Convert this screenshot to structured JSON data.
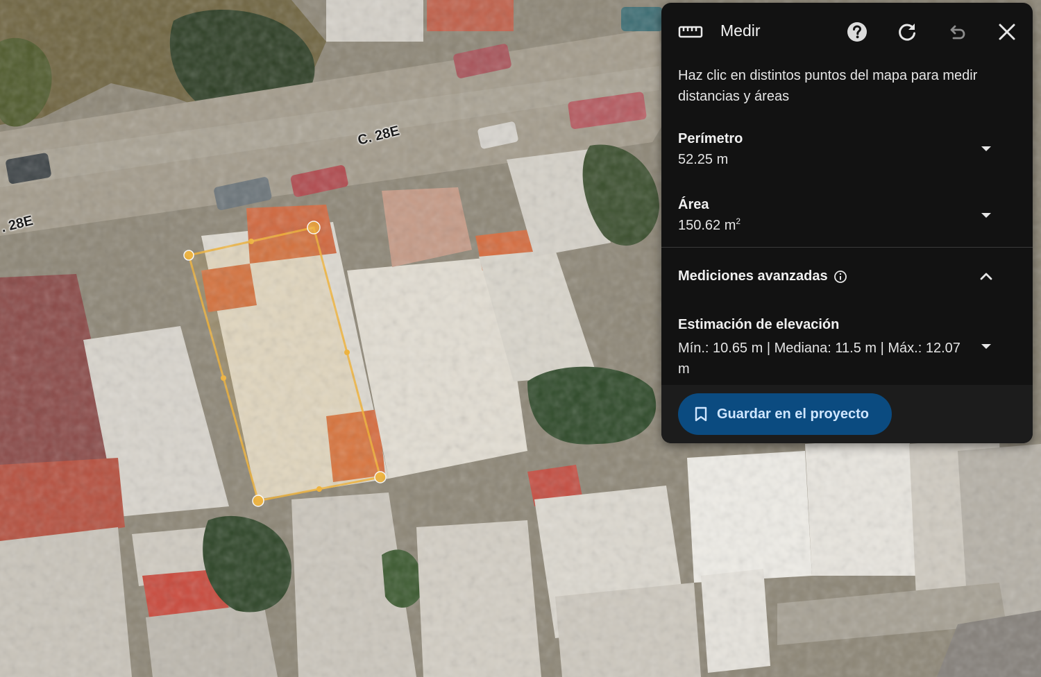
{
  "map": {
    "street_labels": [
      "C. 28E",
      ". 28E"
    ]
  },
  "panel": {
    "title": "Medir",
    "instructions": "Haz clic en distintos puntos del mapa para medir distancias y áreas",
    "perimeter": {
      "label": "Perímetro",
      "value": "52.25 m"
    },
    "area": {
      "label": "Área",
      "value": "150.62 m",
      "unit_sup": "2"
    },
    "advanced": {
      "label": "Mediciones avanzadas"
    },
    "elevation": {
      "label": "Estimación de elevación",
      "value": "Mín.: 10.65 m | Mediana: 11.5 m | Máx.: 12.07 m"
    },
    "save_button": "Guardar en el proyecto"
  },
  "colors": {
    "panel_bg": "#121212",
    "button_bg": "#0b4b80",
    "button_text": "#cfe6ff",
    "measure_line": "#f2b233"
  },
  "icons": [
    "ruler-icon",
    "help-icon",
    "refresh-icon",
    "undo-icon",
    "close-icon",
    "chevron-down-icon",
    "chevron-up-icon",
    "info-icon",
    "bookmark-icon"
  ]
}
